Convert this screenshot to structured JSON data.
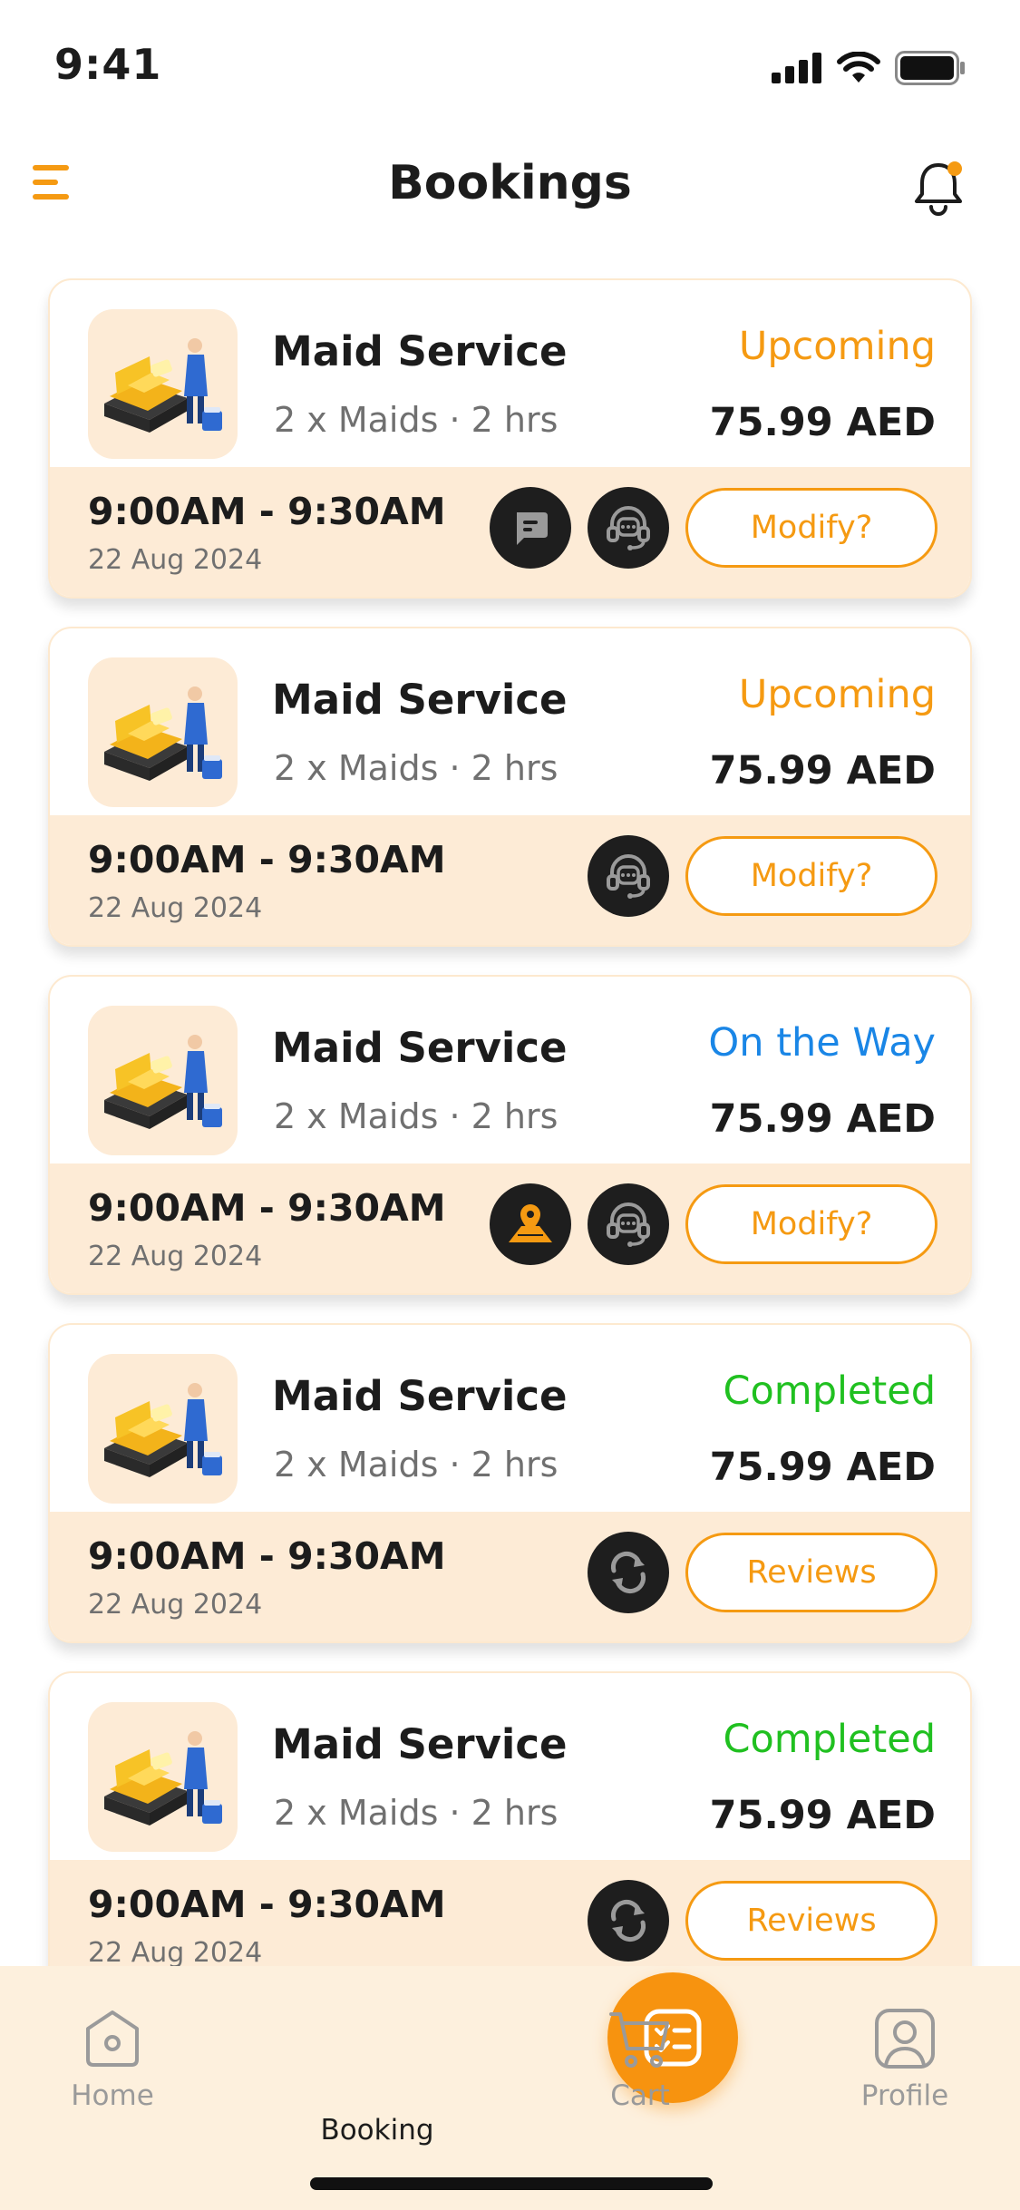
{
  "status_bar": {
    "time": "9:41"
  },
  "header": {
    "title": "Bookings"
  },
  "bookings": [
    {
      "service": "Maid Service",
      "detail": "2 x Maids · 2 hrs",
      "status": "Upcoming",
      "status_class": "c-upcoming",
      "price": "75.99 AED",
      "time": "9:00AM - 9:30AM",
      "date": "22 Aug 2024",
      "icons": [
        "chat-icon",
        "support-icon"
      ],
      "button": "Modify?"
    },
    {
      "service": "Maid Service",
      "detail": "2 x Maids · 2 hrs",
      "status": "Upcoming",
      "status_class": "c-upcoming",
      "price": "75.99 AED",
      "time": "9:00AM - 9:30AM",
      "date": "22 Aug 2024",
      "icons": [
        "support-icon"
      ],
      "button": "Modify?"
    },
    {
      "service": "Maid Service",
      "detail": "2 x Maids · 2 hrs",
      "status": "On the Way",
      "status_class": "c-ontheway",
      "price": "75.99 AED",
      "time": "9:00AM - 9:30AM",
      "date": "22 Aug 2024",
      "icons": [
        "map-pin-icon",
        "support-icon"
      ],
      "button": "Modify?"
    },
    {
      "service": "Maid Service",
      "detail": "2 x Maids · 2 hrs",
      "status": "Completed",
      "status_class": "c-completed",
      "price": "75.99 AED",
      "time": "9:00AM - 9:30AM",
      "date": "22 Aug 2024",
      "icons": [
        "repeat-icon"
      ],
      "button": "Reviews"
    },
    {
      "service": "Maid Service",
      "detail": "2 x Maids · 2 hrs",
      "status": "Completed",
      "status_class": "c-completed",
      "price": "75.99 AED",
      "time": "9:00AM - 9:30AM",
      "date": "22 Aug 2024",
      "icons": [
        "repeat-icon"
      ],
      "button": "Reviews"
    }
  ],
  "tabbar": {
    "home": "Home",
    "booking": "Booking",
    "cart": "Cart",
    "profile": "Profile"
  },
  "colors": {
    "accent": "#f59a12",
    "card_footer": "#fdebd6",
    "upcoming": "#f59a12",
    "on_the_way": "#1a86e6",
    "completed": "#20c020"
  }
}
